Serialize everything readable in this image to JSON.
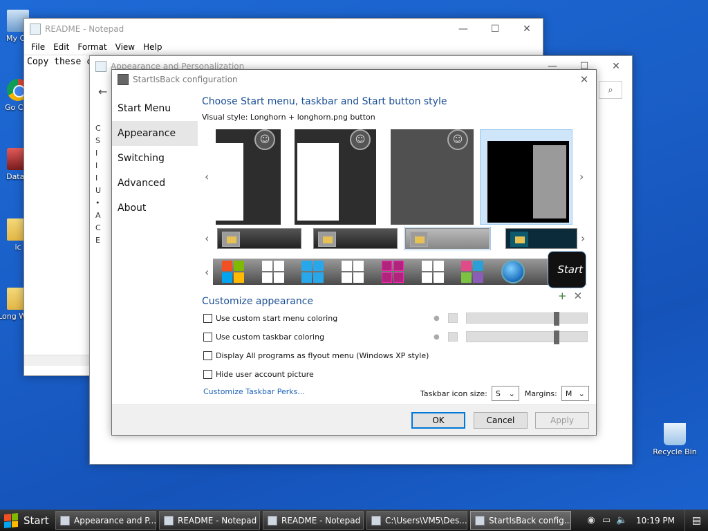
{
  "desktop": {
    "icons": [
      {
        "label": "My Co"
      },
      {
        "label": "Go Chr"
      },
      {
        "label": "DataV"
      },
      {
        "label": "ic"
      },
      {
        "label": "Long Wind"
      },
      {
        "label": "Recycle Bin"
      }
    ]
  },
  "notepad": {
    "title": "README - Notepad",
    "menu": [
      "File",
      "Edit",
      "Format",
      "View",
      "Help"
    ],
    "text": "Copy these c"
  },
  "control_panel": {
    "title": "Appearance and Personalization",
    "left_letters": [
      "C",
      "S",
      "I",
      "I",
      "I",
      "U",
      "•",
      "A",
      "C",
      "E"
    ]
  },
  "dialog": {
    "title": "StartIsBack configuration",
    "nav": [
      "Start Menu",
      "Appearance",
      "Switching",
      "Advanced",
      "About"
    ],
    "selected_nav": "Appearance",
    "heading": "Choose Start menu, taskbar and Start button style",
    "visual_style_label": "Visual style:",
    "visual_style_value": "Longhorn + longhorn.png button",
    "start_orb_text": "Start",
    "customize_heading": "Customize appearance",
    "checkboxes": [
      {
        "label": "Use custom start menu coloring",
        "checked": false
      },
      {
        "label": "Use custom taskbar coloring",
        "checked": false
      },
      {
        "label": "Display All programs as flyout menu (Windows XP style)",
        "checked": false
      },
      {
        "label": "Hide user account picture",
        "checked": false
      }
    ],
    "perks_link": "Customize Taskbar Perks...",
    "icon_size_label": "Taskbar icon size:",
    "icon_size_value": "S",
    "margins_label": "Margins:",
    "margins_value": "M",
    "buttons": {
      "ok": "OK",
      "cancel": "Cancel",
      "apply": "Apply"
    }
  },
  "taskbar": {
    "start_label": "Start",
    "tasks": [
      {
        "label": "Appearance and P..."
      },
      {
        "label": "README - Notepad"
      },
      {
        "label": "README - Notepad"
      },
      {
        "label": "C:\\Users\\VM5\\Des..."
      },
      {
        "label": "StartIsBack config..."
      }
    ],
    "clock": "10:19 PM"
  },
  "colors": {
    "accent": "#0078d7",
    "heading": "#1b4f94",
    "link": "#1c62b9"
  }
}
